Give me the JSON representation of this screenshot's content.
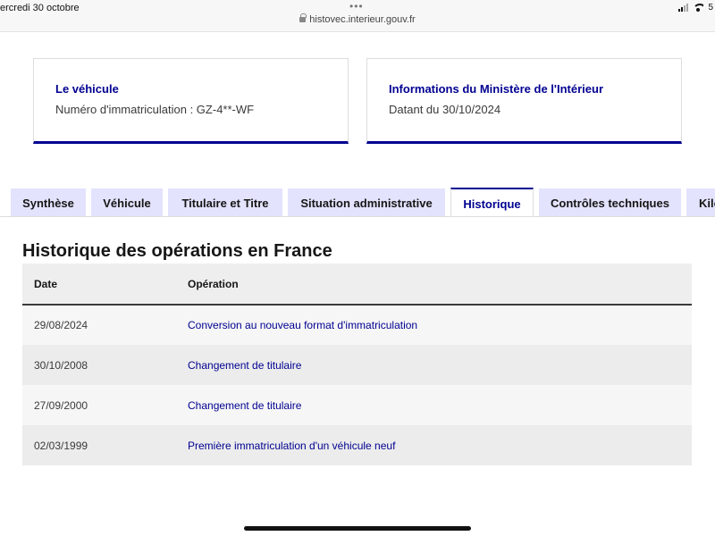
{
  "status_bar": {
    "time": "ercredi 30 octobre",
    "url": "histovec.interieur.gouv.fr",
    "battery": "5"
  },
  "cards": [
    {
      "title": "Le véhicule",
      "text": "Numéro d'immatriculation : GZ-4**-WF"
    },
    {
      "title": "Informations du Ministère de l'Intérieur",
      "text": "Datant du 30/10/2024"
    }
  ],
  "tabs": [
    {
      "label": "Synthèse",
      "active": false
    },
    {
      "label": "Véhicule",
      "active": false
    },
    {
      "label": "Titulaire et Titre",
      "active": false
    },
    {
      "label": "Situation administrative",
      "active": false
    },
    {
      "label": "Historique",
      "active": true
    },
    {
      "label": "Contrôles techniques",
      "active": false
    },
    {
      "label": "Kilo",
      "active": false
    }
  ],
  "history": {
    "title": "Historique des opérations en France",
    "columns": [
      "Date",
      "Opération"
    ],
    "rows": [
      {
        "date": "29/08/2024",
        "operation": "Conversion au nouveau format d'immatriculation"
      },
      {
        "date": "30/10/2008",
        "operation": "Changement de titulaire"
      },
      {
        "date": "27/09/2000",
        "operation": "Changement de titulaire"
      },
      {
        "date": "02/03/1999",
        "operation": "Première immatriculation d'un véhicule neuf"
      }
    ]
  },
  "colors": {
    "accent": "#000091",
    "tab_background": "#e3e3fd"
  }
}
